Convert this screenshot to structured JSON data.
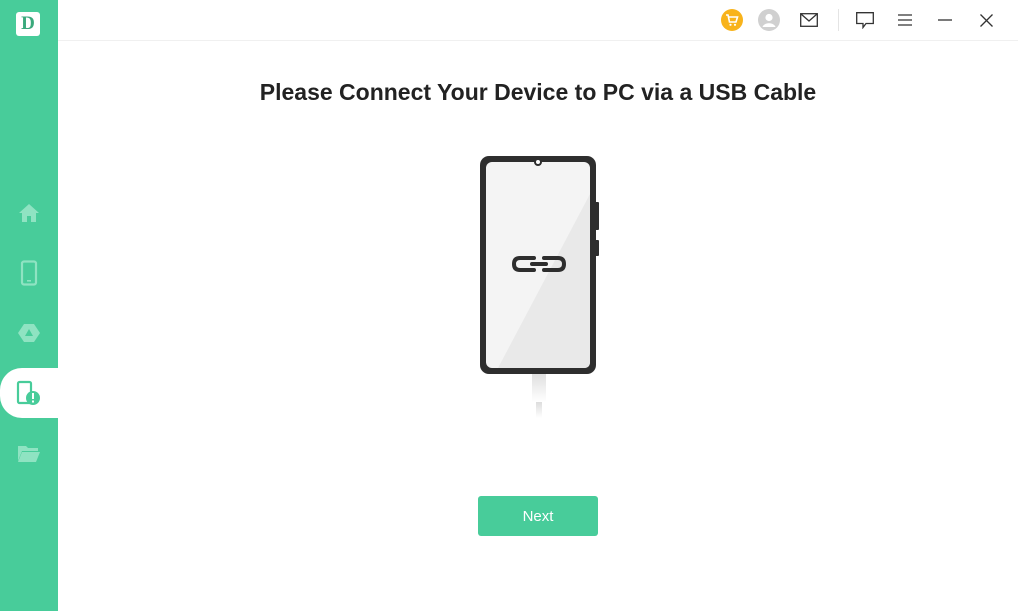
{
  "app": {
    "logo_letter": "D",
    "accent_color": "#48cc9a"
  },
  "sidebar": {
    "items": [
      {
        "icon": "home-icon"
      },
      {
        "icon": "phone-icon"
      },
      {
        "icon": "drive-icon"
      },
      {
        "icon": "phone-alert-icon",
        "active": true
      },
      {
        "icon": "folder-icon"
      }
    ]
  },
  "topbar": {
    "icons": [
      "cart-icon",
      "user-icon",
      "mail-icon",
      "feedback-icon",
      "menu-icon",
      "minimize-icon",
      "close-icon"
    ]
  },
  "main": {
    "title": "Please Connect Your Device to PC via a USB Cable",
    "next_label": "Next"
  }
}
